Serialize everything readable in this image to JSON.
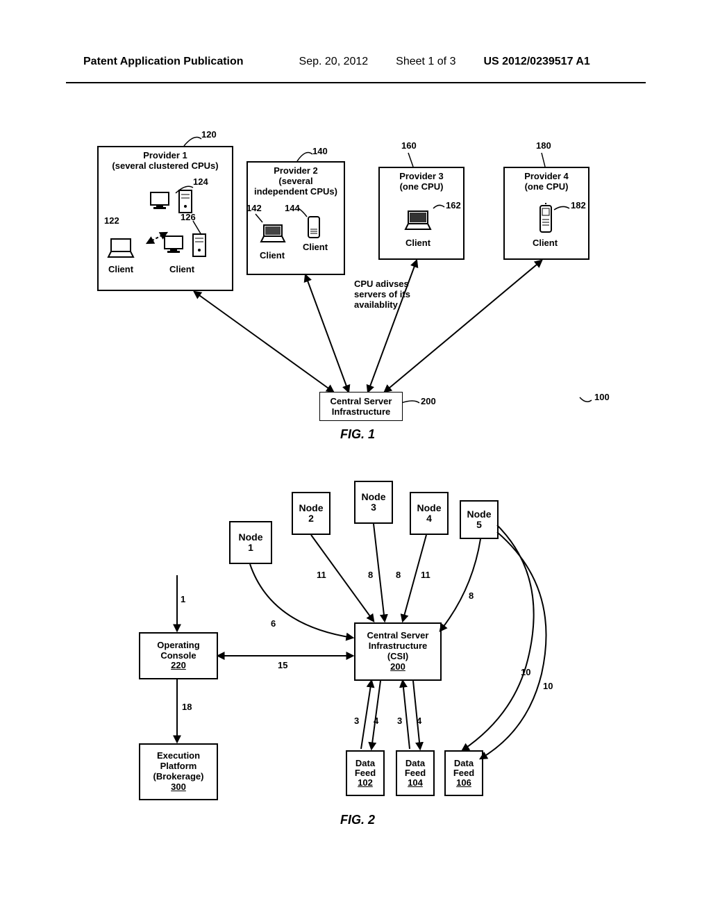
{
  "header": {
    "pub_type": "Patent Application Publication",
    "date": "Sep. 20, 2012",
    "sheet": "Sheet 1 of 3",
    "pubno": "US 2012/0239517 A1"
  },
  "fig1": {
    "providers": {
      "p1": {
        "title": "Provider 1",
        "sub": "(several clustered CPUs)",
        "ref": "120"
      },
      "p2": {
        "title": "Provider 2",
        "sub1": "(several",
        "sub2": "independent CPUs)",
        "ref": "140"
      },
      "p3": {
        "title": "Provider 3",
        "sub": "(one CPU)",
        "ref": "160"
      },
      "p4": {
        "title": "Provider 4",
        "sub": "(one CPU)",
        "ref": "180"
      }
    },
    "client_label": "Client",
    "refs": {
      "r122": "122",
      "r124": "124",
      "r126": "126",
      "r142": "142",
      "r144": "144",
      "r162": "162",
      "r182": "182",
      "r100": "100"
    },
    "cpu_advise": {
      "l1": "CPU adivses",
      "l2": "servers of its",
      "l3": "availablity"
    },
    "server": {
      "l1": "Central Server",
      "l2": "Infrastructure",
      "ref": "200"
    },
    "caption": "FIG. 1"
  },
  "fig2": {
    "nodes": {
      "n1": "Node\n1",
      "n2": "Node\n2",
      "n3": "Node\n3",
      "n4": "Node\n4",
      "n5": "Node\n5"
    },
    "oc": {
      "l1": "Operating",
      "l2": "Console",
      "ref": "220"
    },
    "csi": {
      "l1": "Central Server",
      "l2": "Infrastructure",
      "l3": "(CSI)",
      "ref": "200"
    },
    "ep": {
      "l1": "Execution",
      "l2": "Platform",
      "l3": "(Brokerage)",
      "ref": "300"
    },
    "feeds": {
      "f1": {
        "l1": "Data",
        "l2": "Feed",
        "ref": "102"
      },
      "f2": {
        "l1": "Data",
        "l2": "Feed",
        "ref": "104"
      },
      "f3": {
        "l1": "Data",
        "l2": "Feed",
        "ref": "106"
      }
    },
    "edge_labels": {
      "e1": "1",
      "e6": "6",
      "e11a": "11",
      "e8a": "8",
      "e8b": "8",
      "e11b": "11",
      "e8c": "8",
      "e15": "15",
      "e18": "18",
      "e3a": "3",
      "e4a": "4",
      "e3b": "3",
      "e4b": "4",
      "e10a": "10",
      "e10b": "10"
    },
    "caption": "FIG. 2"
  }
}
